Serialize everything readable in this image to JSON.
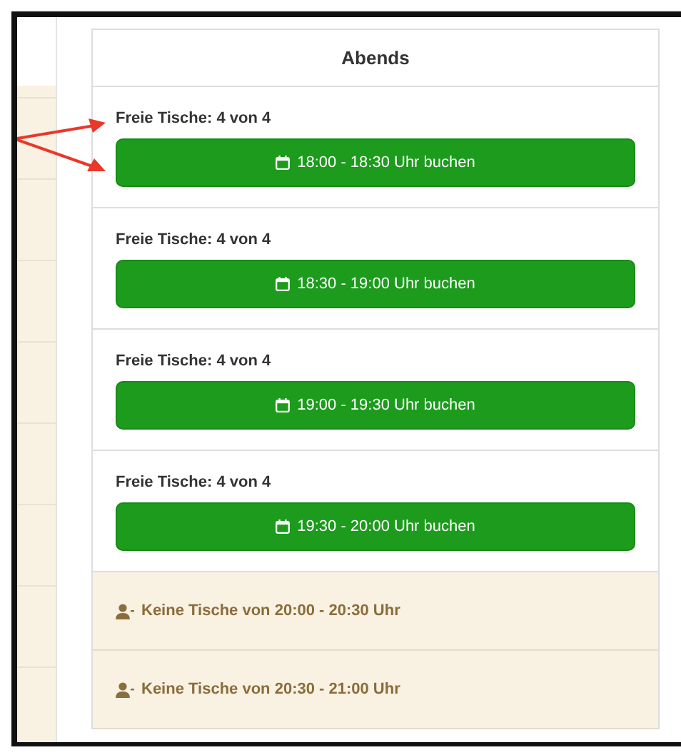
{
  "panel": {
    "title": "Abends",
    "slots": [
      {
        "kind": "available",
        "info": "Freie Tische: 4 von 4",
        "button": "18:00 - 18:30 Uhr buchen"
      },
      {
        "kind": "available",
        "info": "Freie Tische: 4 von 4",
        "button": "18:30 - 19:00 Uhr buchen"
      },
      {
        "kind": "available",
        "info": "Freie Tische: 4 von 4",
        "button": "19:00 - 19:30 Uhr buchen"
      },
      {
        "kind": "available",
        "info": "Freie Tische: 4 von 4",
        "button": "19:30 - 20:00 Uhr buchen"
      },
      {
        "kind": "full",
        "info": "Keine Tische von 20:00 - 20:30 Uhr"
      },
      {
        "kind": "full",
        "info": "Keine Tische von 20:30 - 21:00 Uhr"
      }
    ]
  }
}
